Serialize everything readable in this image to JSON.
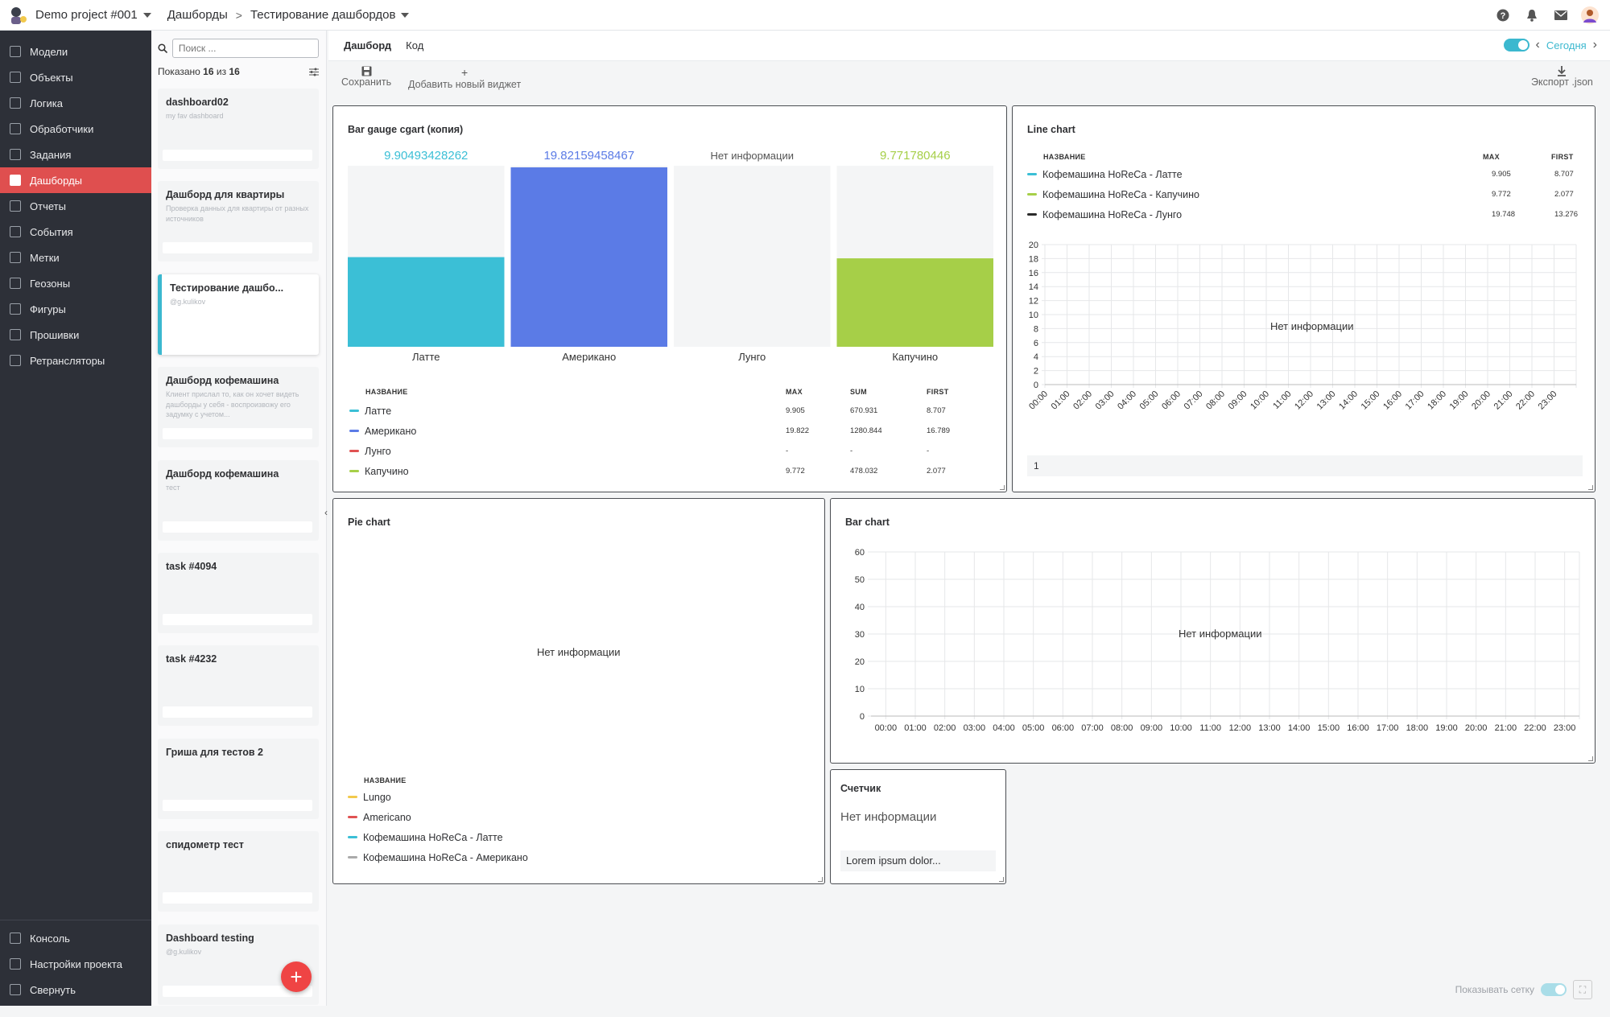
{
  "header": {
    "project": "Demo project #001",
    "breadcrumb": [
      "Дашборды",
      "Тестирование дашбордов"
    ],
    "icons": [
      "help-icon",
      "bell-icon",
      "mail-icon",
      "avatar-icon"
    ]
  },
  "sidebar": {
    "items": [
      {
        "label": "Модели",
        "icon": "cube-icon"
      },
      {
        "label": "Объекты",
        "icon": "object-icon"
      },
      {
        "label": "Логика",
        "icon": "logic-icon"
      },
      {
        "label": "Обработчики",
        "icon": "handler-icon"
      },
      {
        "label": "Задания",
        "icon": "task-icon"
      },
      {
        "label": "Дашборды",
        "icon": "dashboard-icon",
        "active": true
      },
      {
        "label": "Отчеты",
        "icon": "report-icon"
      },
      {
        "label": "События",
        "icon": "event-icon"
      },
      {
        "label": "Метки",
        "icon": "tag-icon"
      },
      {
        "label": "Геозоны",
        "icon": "geozone-icon"
      },
      {
        "label": "Фигуры",
        "icon": "shapes-icon"
      },
      {
        "label": "Прошивки",
        "icon": "firmware-icon"
      },
      {
        "label": "Ретрансляторы",
        "icon": "antenna-icon"
      }
    ],
    "bottom": [
      {
        "label": "Консоль",
        "icon": "console-icon"
      },
      {
        "label": "Настройки проекта",
        "icon": "settings-icon"
      },
      {
        "label": "Свернуть",
        "icon": "chevron-left-icon"
      }
    ]
  },
  "list": {
    "search_placeholder": "Поиск ...",
    "shown_prefix": "Показано",
    "shown_count": "16",
    "shown_sep": "из",
    "shown_total": "16",
    "cards": [
      {
        "title": "dashboard02",
        "subtitle": "my fav dashboard"
      },
      {
        "title": "Дашборд для квартиры",
        "subtitle": "Проверка данных для квартиры от разных источников"
      },
      {
        "title": "Тестирование дашбо...",
        "subtitle": "@g.kulikov",
        "selected": true
      },
      {
        "title": "Дашборд кофемашина",
        "subtitle": "Клиент прислал то, как он хочет видеть дашборды у себя - воспроизвожу его задумку с учетом..."
      },
      {
        "title": "Дашборд кофемашина",
        "subtitle": "тест"
      },
      {
        "title": "task #4094",
        "subtitle": ""
      },
      {
        "title": "task #4232",
        "subtitle": ""
      },
      {
        "title": "Гриша для тестов 2",
        "subtitle": ""
      },
      {
        "title": "спидометр тест",
        "subtitle": ""
      },
      {
        "title": "Dashboard testing",
        "subtitle": "@g.kulikov"
      }
    ],
    "fab_label": "+"
  },
  "tabs": {
    "items": [
      "Дашборд",
      "Код"
    ],
    "today_label": "Сегодня"
  },
  "toolbar": {
    "save": "Сохранить",
    "add_widget": "Добавить новый виджет",
    "export": "Экспорт .json"
  },
  "widgets": {
    "bar_gauge": {
      "title": "Bar gauge cgart (копия)",
      "legend_headers": [
        "НАЗВАНИЕ",
        "MAX",
        "SUM",
        "FIRST"
      ],
      "rows": [
        {
          "name": "Латте",
          "max": "9.905",
          "sum": "670.931",
          "first": "8.707",
          "color": "#3bbfd6"
        },
        {
          "name": "Американо",
          "max": "19.822",
          "sum": "1280.844",
          "first": "16.789",
          "color": "#5b7be6"
        },
        {
          "name": "Лунго",
          "max": "-",
          "sum": "-",
          "first": "-",
          "color": "#e05252"
        },
        {
          "name": "Капучино",
          "max": "9.772",
          "sum": "478.032",
          "first": "2.077",
          "color": "#a6cf48"
        }
      ]
    },
    "line_chart": {
      "title": "Line chart",
      "no_info": "Нет информации",
      "legend_headers": [
        "НАЗВАНИЕ",
        "MAX",
        "FIRST"
      ],
      "rows": [
        {
          "name": "Кофемашина HoReCa - Латте",
          "max": "9.905",
          "first": "8.707",
          "color": "#3bbfd6"
        },
        {
          "name": "Кофемашина HoReCa - Капучино",
          "max": "9.772",
          "first": "2.077",
          "color": "#a6cf48"
        },
        {
          "name": "Кофемашина HoReCa - Лунго",
          "max": "19.748",
          "first": "13.276",
          "color": "#2b2b2b"
        }
      ],
      "page": "1"
    },
    "pie_chart": {
      "title": "Pie chart",
      "no_info": "Нет информации",
      "legend_header": "НАЗВАНИЕ",
      "rows": [
        {
          "name": "Lungo",
          "color": "#f2c94c"
        },
        {
          "name": "Americano",
          "color": "#e05252"
        },
        {
          "name": "Кофемашина HoReCa - Латте",
          "color": "#3bbfd6"
        },
        {
          "name": "Кофемашина HoReCa - Американо",
          "color": "#aaaaaa"
        }
      ]
    },
    "bar_chart": {
      "title": "Bar chart",
      "no_info": "Нет информации"
    },
    "counter": {
      "title": "Счетчик",
      "no_info": "Нет информации",
      "footer": "Lorem ipsum dolor..."
    }
  },
  "grid_toggle_label": "Показывать сетку",
  "chart_data": [
    {
      "type": "bar",
      "title": "Bar gauge cgart (копия)",
      "categories": [
        "Латте",
        "Американо",
        "Лунго",
        "Капучино"
      ],
      "values": [
        9.90493428262,
        19.82159458467,
        null,
        9.771780446
      ],
      "value_labels": [
        "9.90493428262",
        "19.82159458467",
        "Нет информации",
        "9.771780446"
      ],
      "colors": [
        "#3bbfd6",
        "#5b7be6",
        "#e05252",
        "#a6cf48"
      ],
      "ylim": [
        0,
        20
      ]
    },
    {
      "type": "line",
      "title": "Line chart",
      "x": [
        "00:00",
        "01:00",
        "02:00",
        "03:00",
        "04:00",
        "05:00",
        "06:00",
        "07:00",
        "08:00",
        "09:00",
        "10:00",
        "11:00",
        "12:00",
        "13:00",
        "14:00",
        "15:00",
        "16:00",
        "17:00",
        "18:00",
        "19:00",
        "20:00",
        "21:00",
        "22:00",
        "23:00"
      ],
      "yticks": [
        0,
        2,
        4,
        6,
        8,
        10,
        12,
        14,
        16,
        18,
        20
      ],
      "ylim": [
        0,
        20
      ],
      "series": [],
      "grid": true
    },
    {
      "type": "bar",
      "title": "Bar chart",
      "x": [
        "00:00",
        "01:00",
        "02:00",
        "03:00",
        "04:00",
        "05:00",
        "06:00",
        "07:00",
        "08:00",
        "09:00",
        "10:00",
        "11:00",
        "12:00",
        "13:00",
        "14:00",
        "15:00",
        "16:00",
        "17:00",
        "18:00",
        "19:00",
        "20:00",
        "21:00",
        "22:00",
        "23:00"
      ],
      "yticks": [
        0,
        10,
        20,
        30,
        40,
        50,
        60
      ],
      "ylim": [
        0,
        60
      ],
      "series": [],
      "grid": true
    }
  ]
}
